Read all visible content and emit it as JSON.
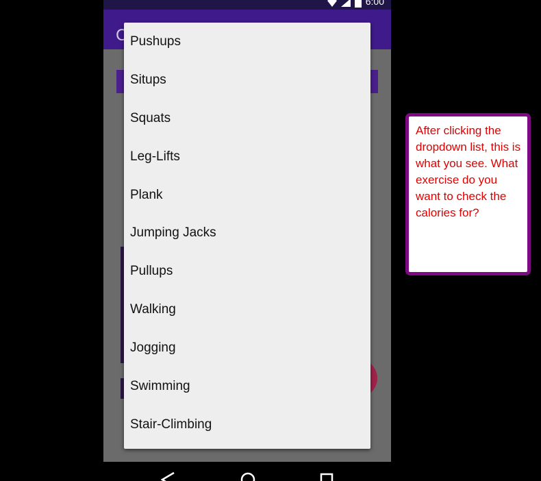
{
  "status_bar": {
    "time": "6:00",
    "icons": [
      "wifi-icon",
      "cell-signal-icon",
      "battery-icon"
    ]
  },
  "app_bar": {
    "title": "C"
  },
  "dropdown": {
    "items": [
      {
        "label": "Pushups"
      },
      {
        "label": "Situps"
      },
      {
        "label": "Squats"
      },
      {
        "label": "Leg-Lifts"
      },
      {
        "label": "Plank"
      },
      {
        "label": "Jumping Jacks"
      },
      {
        "label": "Pullups"
      },
      {
        "label": "Walking"
      },
      {
        "label": "Jogging"
      },
      {
        "label": "Swimming"
      },
      {
        "label": "Stair-Climbing"
      }
    ]
  },
  "navigation": {
    "buttons": [
      "back-icon",
      "home-icon",
      "recents-icon"
    ]
  },
  "callout": {
    "text": "After clicking the dropdown list, this is what you see. What exercise do you want to check the calories for?"
  },
  "colors": {
    "app_bar": "#3f1a8a",
    "status_bar": "#1f1546",
    "scrim": "#6b6b6b",
    "dropdown_bg": "#eeeeee",
    "fab": "#a0224a",
    "callout_border": "#7d0a82",
    "callout_text": "#e00000"
  }
}
